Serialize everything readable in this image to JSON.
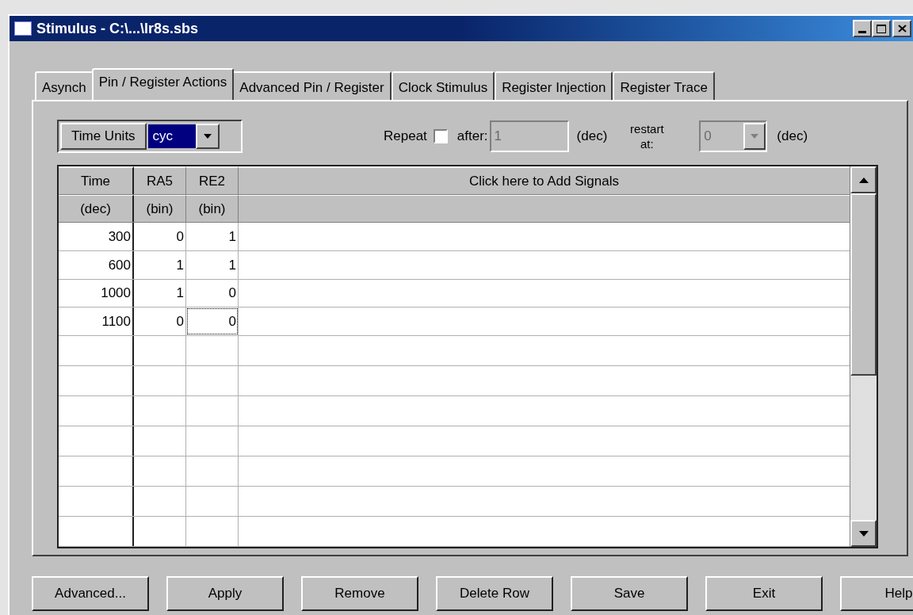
{
  "window": {
    "title": "Stimulus - C:\\...\\lr8s.sbs"
  },
  "tabs": [
    {
      "label": "Asynch",
      "selected": false
    },
    {
      "label": "Pin / Register Actions",
      "selected": true
    },
    {
      "label": "Advanced Pin / Register",
      "selected": false
    },
    {
      "label": "Clock Stimulus",
      "selected": false
    },
    {
      "label": "Register Injection",
      "selected": false
    },
    {
      "label": "Register Trace",
      "selected": false
    }
  ],
  "time_units": {
    "label": "Time Units",
    "value": "cyc"
  },
  "repeat": {
    "label": "Repeat",
    "checked": false,
    "after_label": "after:",
    "after_value": "1",
    "after_unit": "(dec)",
    "restart_label": "restart at:",
    "restart_value": "0",
    "restart_unit": "(dec)",
    "disabled": true
  },
  "grid": {
    "columns": [
      {
        "name": "Time",
        "unit": "(dec)"
      },
      {
        "name": "RA5",
        "unit": "(bin)"
      },
      {
        "name": "RE2",
        "unit": "(bin)"
      }
    ],
    "add_signals": "Click here to Add Signals",
    "rows": [
      {
        "cells": [
          {
            "value": "300",
            "focused": false
          },
          {
            "value": "0",
            "focused": false
          },
          {
            "value": "1",
            "focused": false
          }
        ]
      },
      {
        "cells": [
          {
            "value": "600",
            "focused": false
          },
          {
            "value": "1",
            "focused": false
          },
          {
            "value": "1",
            "focused": false
          }
        ]
      },
      {
        "cells": [
          {
            "value": "1000",
            "focused": false
          },
          {
            "value": "1",
            "focused": false
          },
          {
            "value": "0",
            "focused": false
          }
        ]
      },
      {
        "cells": [
          {
            "value": "1100",
            "focused": false
          },
          {
            "value": "0",
            "focused": false
          },
          {
            "value": "0",
            "focused": true
          }
        ]
      }
    ]
  },
  "buttons": [
    "Advanced...",
    "Apply",
    "Remove",
    "Delete Row",
    "Save",
    "Exit",
    "Help"
  ]
}
